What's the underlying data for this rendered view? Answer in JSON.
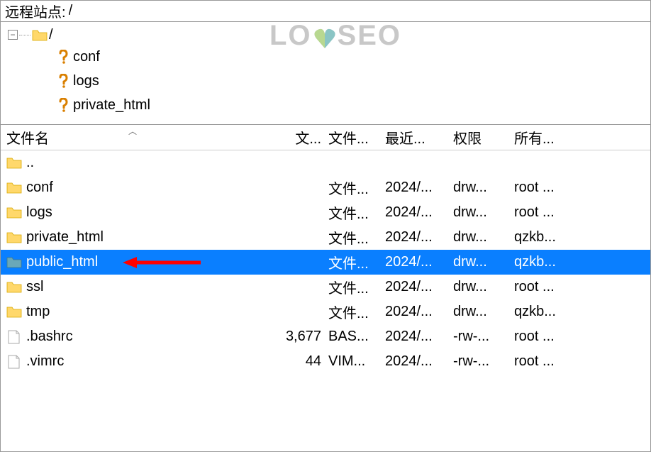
{
  "remote": {
    "label": "远程站点:",
    "path": "/"
  },
  "watermark": {
    "l": "LO",
    "r": "SEO"
  },
  "tree": {
    "root": "/",
    "children": [
      {
        "name": "conf"
      },
      {
        "name": "logs"
      },
      {
        "name": "private_html"
      }
    ]
  },
  "columns": {
    "name": "文件名",
    "size": "文...",
    "type": "文件...",
    "date": "最近...",
    "perm": "权限",
    "owner": "所有..."
  },
  "rows": [
    {
      "icon": "folder",
      "name": "..",
      "size": "",
      "type": "",
      "date": "",
      "perm": "",
      "owner": "",
      "selected": false
    },
    {
      "icon": "folder",
      "name": "conf",
      "size": "",
      "type": "文件...",
      "date": "2024/...",
      "perm": "drw...",
      "owner": "root ...",
      "selected": false
    },
    {
      "icon": "folder",
      "name": "logs",
      "size": "",
      "type": "文件...",
      "date": "2024/...",
      "perm": "drw...",
      "owner": "root ...",
      "selected": false
    },
    {
      "icon": "folder",
      "name": "private_html",
      "size": "",
      "type": "文件...",
      "date": "2024/...",
      "perm": "drw...",
      "owner": "qzkb...",
      "selected": false
    },
    {
      "icon": "folder",
      "name": "public_html",
      "size": "",
      "type": "文件...",
      "date": "2024/...",
      "perm": "drw...",
      "owner": "qzkb...",
      "selected": true,
      "arrow": true
    },
    {
      "icon": "folder",
      "name": "ssl",
      "size": "",
      "type": "文件...",
      "date": "2024/...",
      "perm": "drw...",
      "owner": "root ...",
      "selected": false
    },
    {
      "icon": "folder",
      "name": "tmp",
      "size": "",
      "type": "文件...",
      "date": "2024/...",
      "perm": "drw...",
      "owner": "qzkb...",
      "selected": false
    },
    {
      "icon": "file",
      "name": ".bashrc",
      "size": "3,677",
      "type": "BAS...",
      "date": "2024/...",
      "perm": "-rw-...",
      "owner": "root ...",
      "selected": false
    },
    {
      "icon": "file",
      "name": ".vimrc",
      "size": "44",
      "type": "VIM...",
      "date": "2024/...",
      "perm": "-rw-...",
      "owner": "root ...",
      "selected": false
    }
  ]
}
